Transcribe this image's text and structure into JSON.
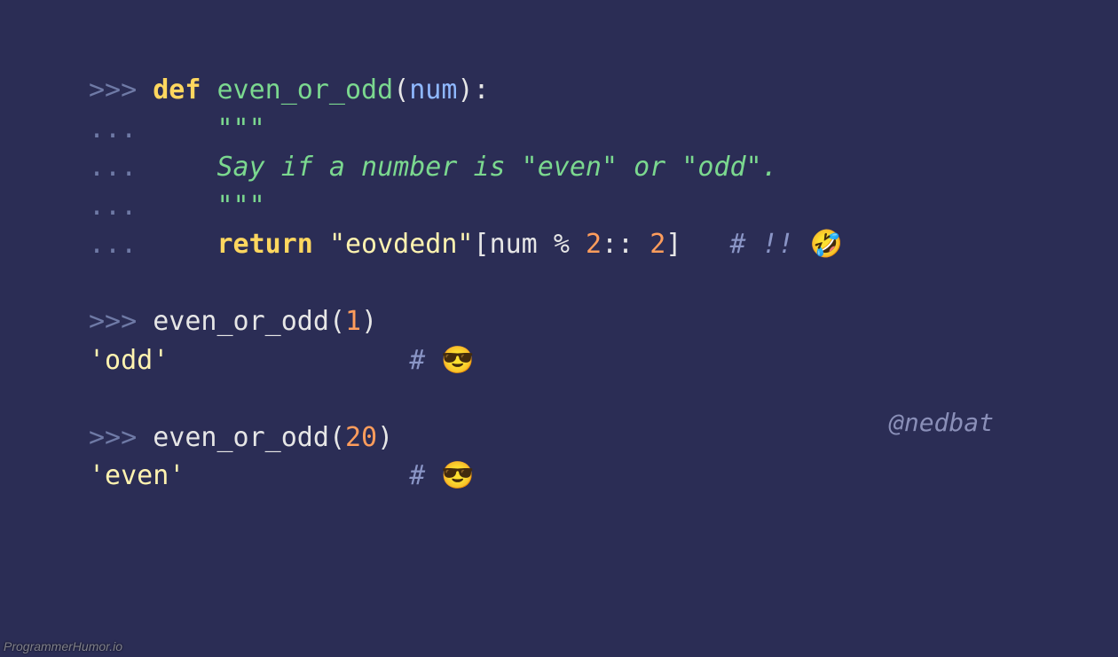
{
  "lines": {
    "l1": {
      "prompt": ">>> ",
      "def": "def ",
      "fn": "even_or_odd",
      "open": "(",
      "param": "num",
      "close": "):"
    },
    "l2": {
      "prompt": "...     ",
      "quotes": "\"\"\""
    },
    "l3": {
      "prompt": "...     ",
      "text": "Say if a number is \"even\" or \"odd\"."
    },
    "l4": {
      "prompt": "...     ",
      "quotes": "\"\"\""
    },
    "l5": {
      "prompt": "...     ",
      "ret": "return ",
      "str": "\"eovdedn\"",
      "br1": "[",
      "id": "num ",
      "op": "% ",
      "n1": "2",
      "sep": ":: ",
      "n2": "2",
      "br2": "]   ",
      "com": "# !! ",
      "emoji": "🤣"
    },
    "l6": {
      "prompt": ">>> ",
      "fn": "even_or_odd",
      "open": "(",
      "arg": "1",
      "close": ")"
    },
    "l7": {
      "out": "'odd'",
      "pad": "               ",
      "com": "# ",
      "emoji": "😎"
    },
    "l8": {
      "prompt": ">>> ",
      "fn": "even_or_odd",
      "open": "(",
      "arg": "20",
      "close": ")"
    },
    "l9": {
      "out": "'even'",
      "pad": "              ",
      "com": "# ",
      "emoji": "😎"
    }
  },
  "attribution": "@nedbat",
  "watermark": "ProgrammerHumor.io"
}
